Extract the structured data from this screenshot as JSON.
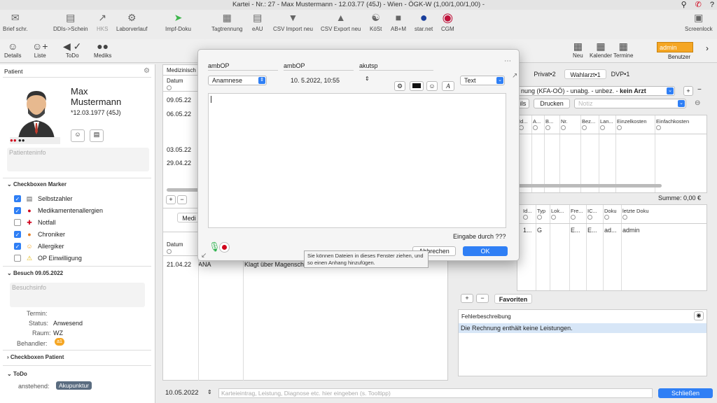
{
  "window": {
    "title": "Kartei - Nr.: 27 - Max Mustermann - 12.03.77 (45J) - Wien - ÖGK-W (1,00/1,00/1,00) -"
  },
  "toolbar": [
    {
      "label": "Brief schr.",
      "icon": "letter-icon"
    },
    {
      "label": "DDIs->Schein",
      "icon": "document-icon"
    },
    {
      "label": "HKS",
      "icon": "hks-icon"
    },
    {
      "label": "Laborverlauf",
      "icon": "flask-icon"
    },
    {
      "label": "Impf-Doku",
      "icon": "syringe-icon"
    },
    {
      "label": "Tagtrennung",
      "icon": "calendar-icon"
    },
    {
      "label": "eAU",
      "icon": "eau-icon"
    },
    {
      "label": "CSV Import neu",
      "icon": "triangle-down-icon"
    },
    {
      "label": "CSV Export neu",
      "icon": "triangle-up-icon"
    },
    {
      "label": "KöSt",
      "icon": "vitruvian-icon"
    },
    {
      "label": "AB+M",
      "icon": "abm-icon"
    },
    {
      "label": "star.net",
      "icon": "starnet-icon"
    },
    {
      "label": "CGM",
      "icon": "cgm-icon"
    },
    {
      "label": "Screenlock",
      "icon": "screen-icon"
    }
  ],
  "toolbar2": [
    {
      "label": "Details",
      "icon": "person-icon"
    },
    {
      "label": "Liste",
      "icon": "person-add-icon"
    },
    {
      "label": "ToDo",
      "icon": "back-icon"
    },
    {
      "label": "Mediks",
      "icon": "pills-icon"
    }
  ],
  "toolbar2_right": [
    {
      "label": "Neu",
      "icon": "calendar-add-icon"
    },
    {
      "label": "Kalender",
      "icon": "calendar-icon"
    },
    {
      "label": "Termine",
      "icon": "calendar-icon"
    }
  ],
  "user": {
    "name": "admin",
    "label": "Benutzer"
  },
  "patient": {
    "section_label": "Patient",
    "first_name": "Max",
    "last_name": "Mustermann",
    "dob": "*12.03.1977 (45J)",
    "info_placeholder": "Patienteninfo"
  },
  "markers": {
    "title": "Checkboxen Marker",
    "items": [
      {
        "label": "Selbstzahler",
        "checked": true,
        "icon": "clipboard-icon"
      },
      {
        "label": "Medikamentenallergien",
        "checked": true,
        "icon": "pill-allergy-icon"
      },
      {
        "label": "Notfall",
        "checked": false,
        "icon": "emergency-icon"
      },
      {
        "label": "Chroniker",
        "checked": true,
        "icon": "chronic-icon"
      },
      {
        "label": "Allergiker",
        "checked": true,
        "icon": "allergy-icon"
      },
      {
        "label": "OP Einwilligung",
        "checked": false,
        "icon": "warning-icon"
      }
    ]
  },
  "visit": {
    "title": "Besuch 09.05.2022",
    "info_placeholder": "Besuchsinfo",
    "termin_label": "Termin:",
    "status_label": "Status:",
    "status": "Anwesend",
    "raum_label": "Raum:",
    "raum": "WZ",
    "behandler_label": "Behandler:",
    "behandler_badge": "a1"
  },
  "checkboxes_patient": {
    "title": "Checkboxen Patient"
  },
  "todo": {
    "title": "ToDo",
    "pending_label": "anstehend:",
    "pending_item": "Akupunktur"
  },
  "medical": {
    "header": "Medizinisch",
    "col_date": "Datum",
    "dates": [
      "09.05.22",
      "06.05.22",
      "03.05.22",
      "29.04.22"
    ],
    "lower_tab": "Medi",
    "lower_col_date": "Datum",
    "lower_row": {
      "date": "21.04.22",
      "code": "ANA",
      "text": "Klagt über Magenschme"
    }
  },
  "right_panel": {
    "tabs": [
      "Privat•2",
      "Wahlarzt•1",
      "DVP•1"
    ],
    "selector": "nung (KFA-OÖ) - unabg. - unbez. - ",
    "selector_bold": "kein Arzt",
    "btn_details": "ils",
    "btn_print": "Drucken",
    "notiz_placeholder": "Notiz",
    "columns1": [
      "Id...",
      "A...",
      "B...",
      "Nr.",
      "Bez...",
      "Lan...",
      "Einzelkosten",
      "Einfachkosten"
    ],
    "summe": "Summe: 0,00 €",
    "columns2": [
      "Id...",
      "Typ",
      "Lok...",
      "Fre...",
      "IC...",
      "Doku",
      "letzte Doku"
    ],
    "row2": [
      "1...",
      "G",
      "",
      "E...",
      "E...",
      "ad...",
      "admin"
    ],
    "favorites_tab": "Favoriten",
    "error_title": "Fehlerbeschreibung",
    "error_row": "Die Rechnung enthält keine Leistungen."
  },
  "dialog": {
    "fields": [
      "ambOP",
      "ambOP",
      "akutsp"
    ],
    "type_select": "Anamnese",
    "datetime": "10.  5.2022, 10:55",
    "format_select": "Text",
    "prompt": "Eingabe durch ???",
    "cancel": "Abbrechen",
    "ok": "OK"
  },
  "tooltip": "Sie können Dateien in dieses Fenster ziehen, und so einen Anhang hinzufügen.",
  "bottom": {
    "date": "10.05.2022",
    "entry_placeholder": "Karteieintrag, Leistung, Diagnose etc. hier eingeben (s. Tooltipp)",
    "close": "Schließen"
  }
}
